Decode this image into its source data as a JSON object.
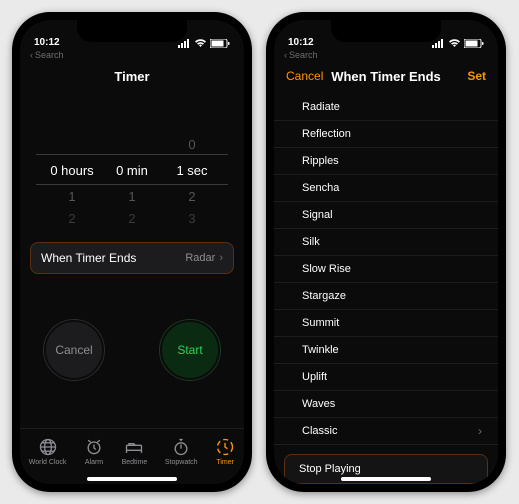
{
  "status": {
    "time": "10:12",
    "back_label": "Search"
  },
  "left": {
    "title": "Timer",
    "picker": {
      "hours": {
        "sel": "0 hours",
        "below1": "1",
        "below2": "2"
      },
      "minutes": {
        "sel": "0 min",
        "below1": "1",
        "below2": "2"
      },
      "seconds": {
        "above": "0",
        "sel": "1 sec",
        "below1": "2",
        "below2": "3"
      }
    },
    "ends_row": {
      "label": "When Timer Ends",
      "value": "Radar"
    },
    "cancel": "Cancel",
    "start": "Start",
    "tabs": {
      "world_clock": "World Clock",
      "alarm": "Alarm",
      "bedtime": "Bedtime",
      "stopwatch": "Stopwatch",
      "timer": "Timer"
    }
  },
  "right": {
    "cancel": "Cancel",
    "title": "When Timer Ends",
    "set": "Set",
    "sounds": [
      "Radiate",
      "Reflection",
      "Ripples",
      "Sencha",
      "Signal",
      "Silk",
      "Slow Rise",
      "Stargaze",
      "Summit",
      "Twinkle",
      "Uplift",
      "Waves",
      "Classic"
    ],
    "stop_playing": "Stop Playing"
  }
}
